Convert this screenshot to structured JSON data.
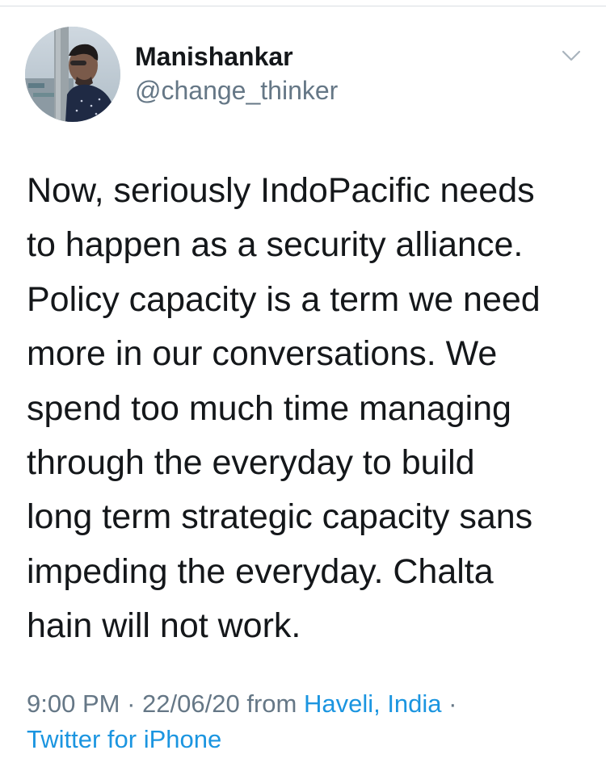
{
  "tweet": {
    "author": {
      "display_name": "Manishankar",
      "handle": "@change_thinker"
    },
    "body_lines": [
      "Now, seriously IndoPacific needs",
      "to happen as a security alliance.",
      "Policy capacity is a term we need",
      "more in our conversations. We",
      "spend too much time managing",
      "through the everyday to build",
      "long term strategic capacity sans",
      "impeding the everyday. Chalta",
      "hain will not work."
    ],
    "meta": {
      "time": "9:00 PM",
      "separator": "·",
      "date": "22/06/20",
      "from_label": "from",
      "location": "Haveli, India",
      "source": "Twitter for iPhone"
    },
    "icons": {
      "menu": "chevron-down-icon"
    }
  },
  "colors": {
    "text_primary": "#14171a",
    "text_secondary": "#657786",
    "link": "#1b95e0",
    "divider": "#d9dde2"
  }
}
